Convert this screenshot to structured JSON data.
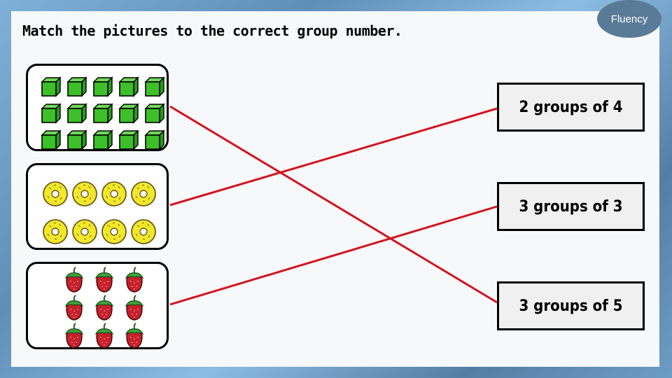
{
  "badge": {
    "label": "Fluency"
  },
  "instruction": "Match the pictures to the correct group number.",
  "colors": {
    "line": "#d2141e",
    "cube": "#3cbf28",
    "donut": "#f2e82a",
    "strawberry": "#c8202a",
    "leaf": "#3fa33a",
    "badge": "#5a7b97"
  },
  "picture_groups": [
    {
      "name": "cubes",
      "icon": "green-cube-icon",
      "rows": 3,
      "per_row": 5,
      "count": 15
    },
    {
      "name": "donuts",
      "icon": "yellow-donut-icon",
      "rows": 2,
      "per_row": 4,
      "count": 8
    },
    {
      "name": "strawberries",
      "icon": "strawberry-icon",
      "rows": 3,
      "per_row": 3,
      "count": 9
    }
  ],
  "answers": [
    {
      "label": "2 groups of 4"
    },
    {
      "label": "3 groups of 3"
    },
    {
      "label": "3 groups of 5"
    }
  ],
  "matches": [
    {
      "picture": 0,
      "answer": 2
    },
    {
      "picture": 1,
      "answer": 0
    },
    {
      "picture": 2,
      "answer": 1
    }
  ]
}
